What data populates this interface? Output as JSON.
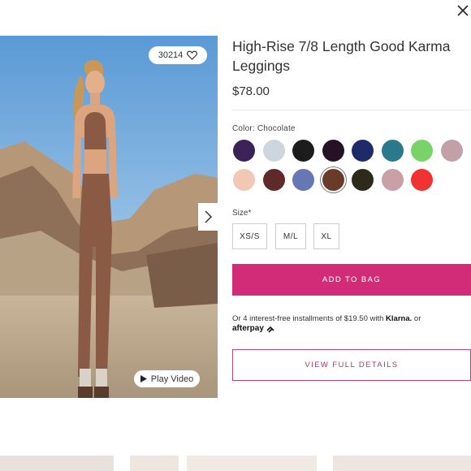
{
  "modal": {
    "close_icon": "close-icon"
  },
  "photo": {
    "likes_count": "30214",
    "heart_icon": "heart-icon",
    "next_icon": "chevron-right-icon",
    "play_video_label": "Play Video",
    "play_icon": "play-icon"
  },
  "product": {
    "title": "High-Rise 7/8 Length Good Karma Leggings",
    "price": "$78.00",
    "color_label": "Color: Chocolate",
    "colors": [
      {
        "name": "purple",
        "hex": "#3b2259"
      },
      {
        "name": "light-grey",
        "hex": "#cdd5df"
      },
      {
        "name": "black",
        "hex": "#1c1c1c"
      },
      {
        "name": "plum-black",
        "hex": "#271127"
      },
      {
        "name": "navy",
        "hex": "#1f2a6b"
      },
      {
        "name": "teal",
        "hex": "#2a7a8c"
      },
      {
        "name": "light-green",
        "hex": "#79d36a"
      },
      {
        "name": "mauve",
        "hex": "#c2a0a8"
      },
      {
        "name": "blush",
        "hex": "#f2c8b4"
      },
      {
        "name": "burgundy",
        "hex": "#5e2a2a"
      },
      {
        "name": "periwinkle",
        "hex": "#6776b5"
      },
      {
        "name": "chocolate",
        "hex": "#6a3a2a",
        "selected": true
      },
      {
        "name": "olive-black",
        "hex": "#2c2a1a"
      },
      {
        "name": "dusty-rose",
        "hex": "#c9a0a5"
      },
      {
        "name": "red",
        "hex": "#f03232"
      }
    ],
    "size_label": "Size*",
    "sizes": [
      "XS/S",
      "M/L",
      "XL"
    ]
  },
  "actions": {
    "add_to_bag": "ADD TO BAG",
    "installments_text": "Or 4 interest-free installments of $19.50 with",
    "klarna": "Klarna.",
    "or_text": "or",
    "afterpay": "afterpay",
    "view_full_details": "VIEW FULL DETAILS"
  },
  "colors": {
    "accent": "#d22b78",
    "outline_accent": "#b5457a"
  }
}
